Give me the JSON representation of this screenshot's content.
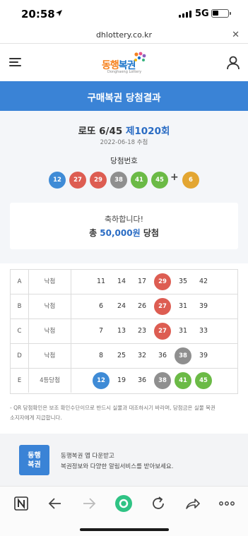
{
  "status_bar": {
    "time": "20:58",
    "network": "5G"
  },
  "browser": {
    "url": "dhlottery.co.kr"
  },
  "header": {
    "logo_text_1": "동행",
    "logo_text_2": "복권",
    "logo_sub": "Donghaeng Lottery"
  },
  "banner": {
    "title": "구매복권 당첨결과"
  },
  "draw": {
    "game": "로또 6/45",
    "round": "제1020회",
    "date": "2022-06-18 추첨",
    "winning_label": "당첨번호",
    "winning_numbers": [
      {
        "value": "12",
        "color": "#3f8bd6"
      },
      {
        "value": "27",
        "color": "#dd5d52"
      },
      {
        "value": "29",
        "color": "#dd5d52"
      },
      {
        "value": "38",
        "color": "#8f8f8f"
      },
      {
        "value": "41",
        "color": "#6bba46"
      },
      {
        "value": "45",
        "color": "#6bba46"
      }
    ],
    "plus": "+",
    "bonus_number": {
      "value": "6",
      "color": "#e3a632"
    }
  },
  "result": {
    "congrats": "축하합니다!",
    "prize_prefix": "총",
    "prize_amount": "50,000원",
    "prize_suffix": "당첨"
  },
  "tickets": [
    {
      "letter": "A",
      "status": "낙첨",
      "numbers": [
        {
          "value": "11",
          "hit": ""
        },
        {
          "value": "14",
          "hit": ""
        },
        {
          "value": "17",
          "hit": ""
        },
        {
          "value": "29",
          "hit": "red"
        },
        {
          "value": "35",
          "hit": ""
        },
        {
          "value": "42",
          "hit": ""
        }
      ]
    },
    {
      "letter": "B",
      "status": "낙첨",
      "numbers": [
        {
          "value": "6",
          "hit": ""
        },
        {
          "value": "24",
          "hit": ""
        },
        {
          "value": "26",
          "hit": ""
        },
        {
          "value": "27",
          "hit": "red"
        },
        {
          "value": "31",
          "hit": ""
        },
        {
          "value": "39",
          "hit": ""
        }
      ]
    },
    {
      "letter": "C",
      "status": "낙첨",
      "numbers": [
        {
          "value": "7",
          "hit": ""
        },
        {
          "value": "13",
          "hit": ""
        },
        {
          "value": "23",
          "hit": ""
        },
        {
          "value": "27",
          "hit": "red"
        },
        {
          "value": "31",
          "hit": ""
        },
        {
          "value": "33",
          "hit": ""
        }
      ]
    },
    {
      "letter": "D",
      "status": "낙첨",
      "numbers": [
        {
          "value": "8",
          "hit": ""
        },
        {
          "value": "25",
          "hit": ""
        },
        {
          "value": "32",
          "hit": ""
        },
        {
          "value": "36",
          "hit": ""
        },
        {
          "value": "38",
          "hit": "gray"
        },
        {
          "value": "39",
          "hit": ""
        }
      ]
    },
    {
      "letter": "E",
      "status": "4등당첨",
      "numbers": [
        {
          "value": "12",
          "hit": "blue"
        },
        {
          "value": "19",
          "hit": ""
        },
        {
          "value": "36",
          "hit": ""
        },
        {
          "value": "38",
          "hit": "gray"
        },
        {
          "value": "41",
          "hit": "green"
        },
        {
          "value": "45",
          "hit": "green"
        }
      ]
    }
  ],
  "note": {
    "line1": "- QR 당첨확인은 보조 확인수단이므로 반드시 실물과 대조하시기 바라며, 당첨금은 실물 복권",
    "line2": "소지자에게 지급합니다."
  },
  "promo": {
    "logo_line1": "동행",
    "logo_line2": "복권",
    "line1": "동행복권 앱 다운받고",
    "line2": "복권정보와 다양한 알림서비스를 받아보세요."
  },
  "toolbar": {
    "items": [
      "naver-icon",
      "back-icon",
      "forward-icon",
      "home-icon",
      "refresh-icon",
      "share-icon",
      "more-icon"
    ]
  }
}
